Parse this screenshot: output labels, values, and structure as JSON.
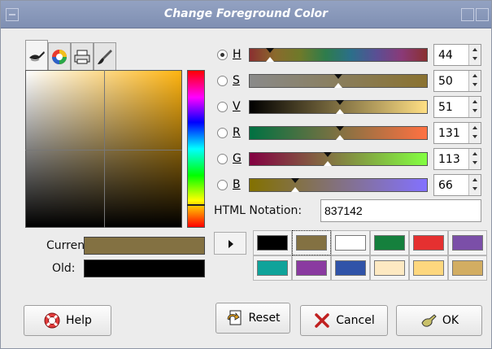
{
  "window": {
    "title": "Change Foreground Color"
  },
  "tabs": [
    {
      "icon": "ink-brush-icon"
    },
    {
      "icon": "color-wheel-icon"
    },
    {
      "icon": "printer-icon"
    },
    {
      "icon": "paintbrush-icon"
    }
  ],
  "color_area": {
    "hue_color": "#ffb410",
    "current_label": "Current:",
    "old_label": "Old:",
    "current_color": "#837142",
    "old_color": "#000000"
  },
  "channels": [
    {
      "label": "H",
      "value": "44",
      "selected": true,
      "level": 0.12,
      "gradient": "linear-gradient(to right, #8a3030, #8a6a2c, #6e7a2a, #2e7c4c, #2b6f8a, #5a4f94, #8a3a78, #8a3030)"
    },
    {
      "label": "S",
      "value": "50",
      "selected": false,
      "level": 0.5,
      "gradient": "linear-gradient(to right, #8a8a8a, #8a7230)"
    },
    {
      "label": "V",
      "value": "51",
      "selected": false,
      "level": 0.51,
      "gradient": "linear-gradient(to right, #000000, #ffdf84)"
    },
    {
      "label": "R",
      "value": "131",
      "selected": false,
      "level": 0.51,
      "gradient": "linear-gradient(to right, #007142, #ff7142)"
    },
    {
      "label": "G",
      "value": "113",
      "selected": false,
      "level": 0.44,
      "gradient": "linear-gradient(to right, #830042, #83ff42)"
    },
    {
      "label": "B",
      "value": "66",
      "selected": false,
      "level": 0.26,
      "gradient": "linear-gradient(to right, #837100, #8371ff)"
    }
  ],
  "html_notation": {
    "label": "HTML Notation:",
    "value": "837142"
  },
  "history": [
    "#000000",
    "#837142",
    "#ffffff",
    "#15803d",
    "#e53030",
    "#7b4fa8",
    "#0fa39a",
    "#8a3aa0",
    "#3053a8",
    "#fde9c2",
    "#fdd77e",
    "#d2ad62"
  ],
  "buttons": {
    "help": "Help",
    "reset": "Reset",
    "cancel": "Cancel",
    "ok": "OK"
  }
}
